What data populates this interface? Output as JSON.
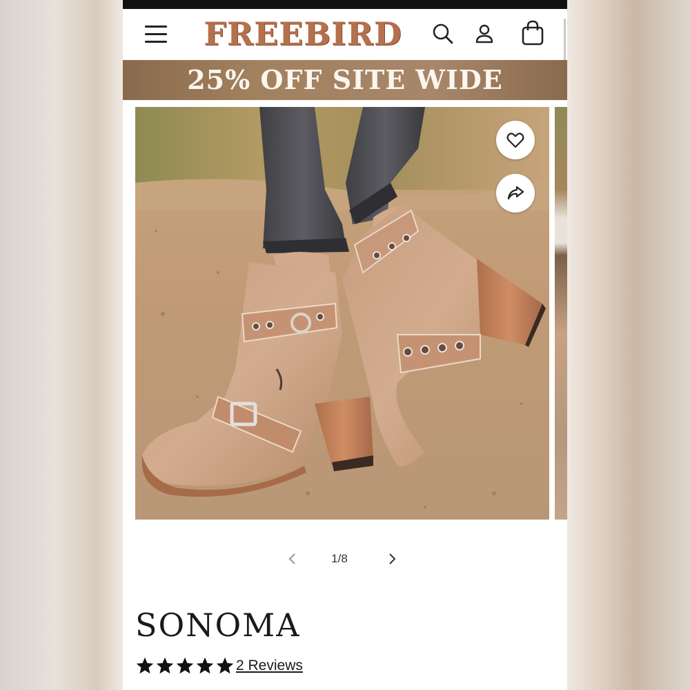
{
  "header": {
    "brand": "FREEBIRD",
    "icons": [
      "menu-icon",
      "search-icon",
      "account-icon",
      "shopping-bag-icon"
    ]
  },
  "promo": {
    "text": "25% OFF SITE WIDE"
  },
  "gallery": {
    "image_alt": "Sonoma distressed leather buckle ankle boots with stacked wood heel",
    "counter": "1/8",
    "progress": {
      "current": 1,
      "total": 8
    },
    "actions": [
      "heart-icon",
      "share-icon"
    ]
  },
  "product": {
    "name": "SONOMA",
    "rating": 5,
    "rating_max": 5,
    "reviews_label": "2 Reviews"
  },
  "colors": {
    "brand": "#b5704d",
    "promo_bg": "#a2815f",
    "text": "#1a1a1a"
  }
}
